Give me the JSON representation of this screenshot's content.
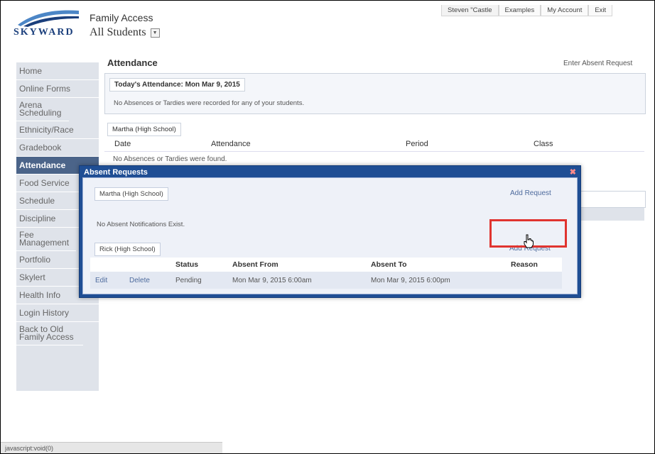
{
  "header": {
    "logo_text": "SKYWARD",
    "app_title": "Family Access",
    "student_select": "All Students",
    "top_links": [
      "Steven \"Castle",
      "Examples",
      "My Account",
      "Exit"
    ]
  },
  "sidebar": {
    "items": [
      {
        "label": "Home"
      },
      {
        "label": "Online Forms"
      },
      {
        "label": "Arena Scheduling"
      },
      {
        "label": "Ethnicity/Race"
      },
      {
        "label": "Gradebook"
      },
      {
        "label": "Attendance"
      },
      {
        "label": "Food Service"
      },
      {
        "label": "Schedule"
      },
      {
        "label": "Discipline"
      },
      {
        "label": "Fee Management"
      },
      {
        "label": "Portfolio"
      },
      {
        "label": "Skylert"
      },
      {
        "label": "Health Info"
      },
      {
        "label": "Login History"
      },
      {
        "label": "Back to Old Family Access"
      }
    ]
  },
  "main": {
    "title": "Attendance",
    "enter_absent_request": "Enter Absent Request",
    "today_label": "Today's Attendance: Mon Mar 9, 2015",
    "today_message": "No Absences or Tardies were recorded for any of your students.",
    "student_tab": "Martha (High School)",
    "columns": [
      "Date",
      "Attendance",
      "Period",
      "Class"
    ],
    "empty_message": "No Absences or Tardies were found."
  },
  "dialog": {
    "title": "Absent Requests",
    "close": "✖",
    "sections": [
      {
        "student": "Martha (High School)",
        "add_request": "Add Request",
        "message": "No Absent Notifications Exist."
      },
      {
        "student": "Rick (High School)",
        "add_request": "Add Request"
      }
    ],
    "columns": [
      "Status",
      "Absent From",
      "Absent To",
      "Reason"
    ],
    "rows": [
      {
        "edit": "Edit",
        "delete": "Delete",
        "status": "Pending",
        "absent_from": "Mon Mar 9, 2015 6:00am",
        "absent_to": "Mon Mar 9, 2015 6:00pm",
        "reason": ""
      }
    ]
  },
  "status_bar": "javascript:void(0)",
  "colors": {
    "dialog_title_bg": "#1f4e94",
    "sidebar_active": "#4b6489",
    "highlight": "#e0342f",
    "link": "#4e6b9d"
  }
}
